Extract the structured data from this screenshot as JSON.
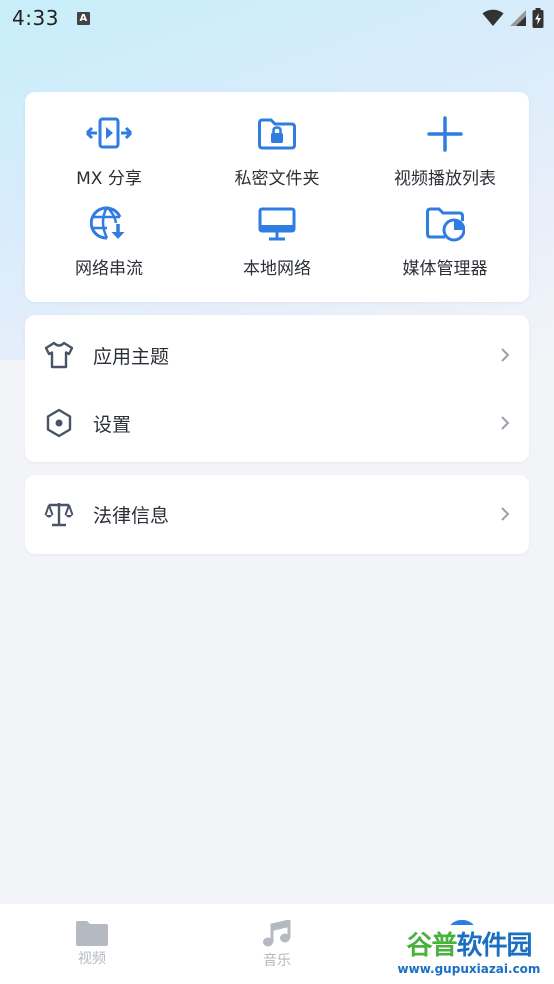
{
  "status_bar": {
    "time": "4:33",
    "a_badge": "A"
  },
  "grid": [
    {
      "label": "MX 分享",
      "icon": "share-transfer-icon"
    },
    {
      "label": "私密文件夹",
      "icon": "locked-folder-icon"
    },
    {
      "label": "视频播放列表",
      "icon": "plus-icon"
    },
    {
      "label": "网络串流",
      "icon": "globe-download-icon"
    },
    {
      "label": "本地网络",
      "icon": "monitor-icon"
    },
    {
      "label": "媒体管理器",
      "icon": "folder-chart-icon"
    }
  ],
  "list1": [
    {
      "label": "应用主题",
      "icon": "tshirt-icon"
    },
    {
      "label": "设置",
      "icon": "hexagon-settings-icon"
    }
  ],
  "list2": [
    {
      "label": "法律信息",
      "icon": "scales-icon"
    }
  ],
  "nav": {
    "video": "视频",
    "music": "音乐"
  },
  "watermark": {
    "green": "谷普",
    "blue": "软件园",
    "url": "www.gupuxiazai.com"
  },
  "colors": {
    "accent": "#2f7de1",
    "text": "#2b2f36",
    "nav_inactive": "#b4b9c2"
  }
}
